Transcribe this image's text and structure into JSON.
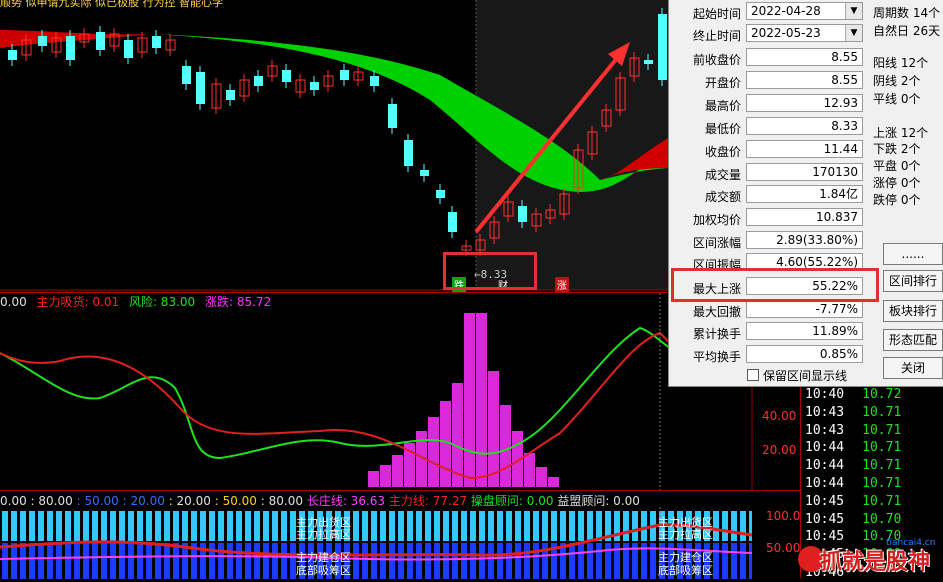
{
  "top_strip": {
    "text": "顺势 似申请九实际 似已极股 行为控 智能心学"
  },
  "chart": {
    "price_label": "8.33",
    "markers": [
      "跌",
      "财",
      "涨"
    ]
  },
  "indicator1": {
    "title": "0.00",
    "items": [
      {
        "label": "主力吸货: 0.01",
        "color": "#ff2020"
      },
      {
        "label": "风险: 83.00",
        "color": "#20e020"
      },
      {
        "label": "涨跌: 85.72",
        "color": "#ff30ff"
      }
    ],
    "axis": [
      "40.00",
      "20.00"
    ]
  },
  "indicator2": {
    "items": [
      {
        "label": "0.00",
        "color": "#e0e0e0"
      },
      {
        "label": ": 80.00",
        "color": "#e0e0e0"
      },
      {
        "label": ": 50.00",
        "color": "#3a6cff"
      },
      {
        "label": ": 20.00",
        "color": "#3a6cff"
      },
      {
        "label": ": 20.00",
        "color": "#e0e0e0"
      },
      {
        "label": ": 50.00",
        "color": "#ffd020"
      },
      {
        "label": ": 80.00",
        "color": "#e0e0e0"
      },
      {
        "label": "长庄线: 36.63",
        "color": "#ff40ff"
      },
      {
        "label": "主力线: 77.27",
        "color": "#ff2020"
      },
      {
        "label": "操盘顾问: 0.00",
        "color": "#20e020"
      },
      {
        "label": "益盟顾问: 0.00",
        "color": "#e0e0e0"
      }
    ],
    "zones": [
      "主力出货区",
      "主力拉高区",
      "主力建仓区",
      "底部吸筹区"
    ],
    "axis": [
      "100.0",
      "50.00"
    ]
  },
  "stats": {
    "start_label": "起始时间",
    "start_value": "2022-04-28",
    "end_label": "终止时间",
    "end_value": "2022-05-23",
    "rows": [
      {
        "label": "前收盘价",
        "value": "8.55"
      },
      {
        "label": "开盘价",
        "value": "8.55"
      },
      {
        "label": "最高价",
        "value": "12.93"
      },
      {
        "label": "最低价",
        "value": "8.33"
      },
      {
        "label": "收盘价",
        "value": "11.44"
      },
      {
        "label": "成交量",
        "value": "170130"
      },
      {
        "label": "成交额",
        "value": "1.84亿"
      },
      {
        "label": "加权均价",
        "value": "10.837"
      },
      {
        "label": "区间涨幅",
        "value": "2.89(33.80%)"
      },
      {
        "label": "区间振幅",
        "value": "4.60(55.22%)"
      },
      {
        "label": "最大上涨",
        "value": "55.22%"
      },
      {
        "label": "最大回撤",
        "value": "-7.77%"
      },
      {
        "label": "累计换手",
        "value": "11.89%"
      },
      {
        "label": "平均换手",
        "value": "0.85%"
      }
    ],
    "side_info": [
      "周期数 14个",
      "自然日 26天",
      "阳线 12个",
      "阴线 2个",
      "平线 0个",
      "上涨 12个",
      "下跌 2个",
      "平盘 0个",
      "涨停 0个",
      "跌停 0个"
    ],
    "buttons": [
      "......",
      "区间排行",
      "板块排行",
      "形态匹配",
      "关闭"
    ],
    "checkbox_label": "保留区间显示线"
  },
  "tape": {
    "rows": [
      {
        "time": "10:40",
        "price": "10.72"
      },
      {
        "time": "10:43",
        "price": "10.71"
      },
      {
        "time": "10:43",
        "price": "10.71"
      },
      {
        "time": "10:44",
        "price": "10.71"
      },
      {
        "time": "10:44",
        "price": "10.71"
      },
      {
        "time": "10:44",
        "price": "10.71"
      },
      {
        "time": "10:45",
        "price": "10.71"
      },
      {
        "time": "10:45",
        "price": "10.70"
      },
      {
        "time": "10:45",
        "price": "10.70"
      },
      {
        "time": "10:45",
        "price": "10.69"
      },
      {
        "time": "10:46",
        "price": ""
      }
    ]
  },
  "watermark": {
    "text": "抓就是股神",
    "sub": "tiancai4.cn"
  },
  "colors": {
    "up": "#ff3030",
    "down": "#54ffff",
    "ma_band": "#00d000",
    "highlight_box": "#e03030"
  }
}
